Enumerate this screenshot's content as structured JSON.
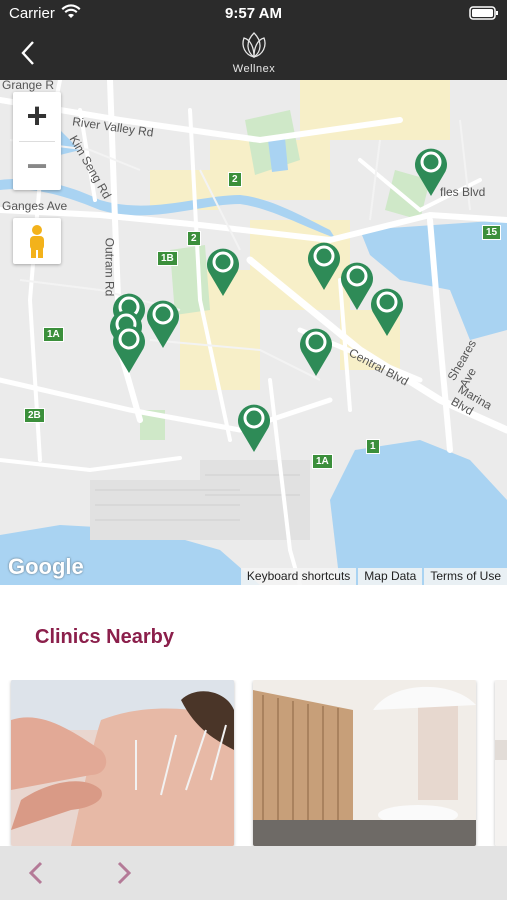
{
  "status": {
    "carrier": "Carrier",
    "time": "9:57 AM"
  },
  "app": {
    "brand": "Wellnex"
  },
  "map": {
    "labels": {
      "grange": "Grange R",
      "river_valley": "River Valley Rd",
      "kim_seng": "Kim Seng Rd",
      "ganges": "Ganges Ave",
      "outram": "Outram Rd",
      "raffles": "fles Blvd",
      "central": "Central Blvd",
      "sheares": "Sheares Ave",
      "marina": "Marina Blvd"
    },
    "shields": [
      "2",
      "2",
      "1B",
      "1A",
      "2B",
      "15",
      "1",
      "1A"
    ],
    "attribution": "Google",
    "footer": {
      "shortcuts": "Keyboard shortcuts",
      "map_data": "Map Data",
      "terms": "Terms of Use"
    },
    "zoom": {
      "plus": "+",
      "minus": "−"
    },
    "accent": "#2e8b57"
  },
  "clinics": {
    "title": "Clinics Nearby"
  },
  "colors": {
    "header": "#2b2b2b",
    "title": "#8b1f4b",
    "arrows": "#b47a97"
  }
}
